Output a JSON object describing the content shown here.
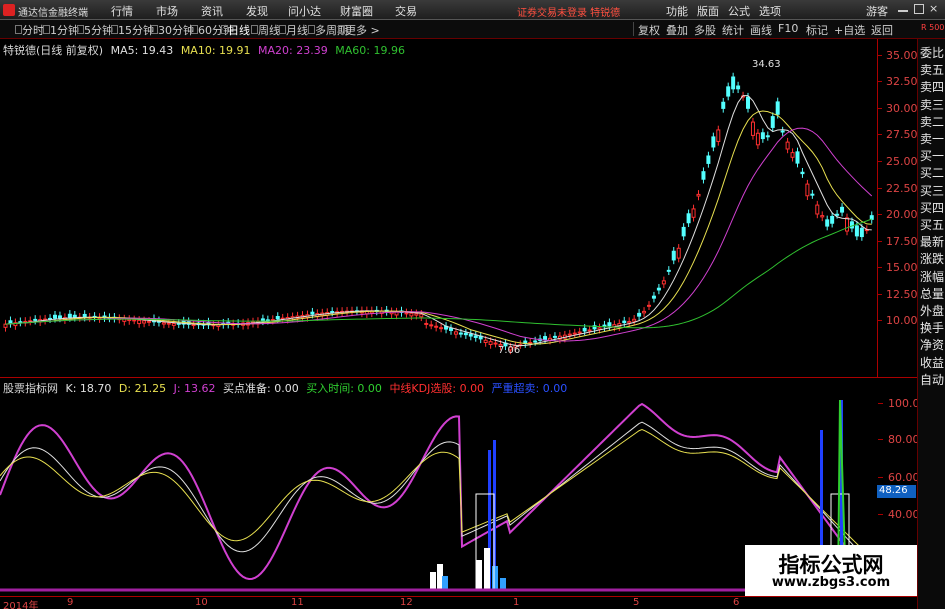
{
  "menubar": {
    "app_title": "通达信金融终端",
    "items": [
      "行情",
      "市场",
      "资讯",
      "发现",
      "问小达",
      "财富圈",
      "交易"
    ],
    "status": "证券交易未登录  特锐德",
    "right_items": [
      "功能",
      "版面",
      "公式",
      "选项"
    ],
    "guest": "游客"
  },
  "toolbar": {
    "periods": [
      "分时",
      "1分钟",
      "5分钟",
      "15分钟",
      "30分钟",
      "60分钟",
      "日线",
      "周线",
      "月线",
      "多周期",
      "更多 >"
    ],
    "active_period": "日线",
    "right_tools": [
      "复权",
      "叠加",
      "多股",
      "统计",
      "画线",
      "F10",
      "标记",
      "+自选",
      "返回"
    ]
  },
  "price_panel": {
    "stock_name": "特锐德(日线 前复权)",
    "ma5": "MA5: 19.43",
    "ma10": "MA10: 19.91",
    "ma20": "MA20: 23.39",
    "ma60": "MA60: 19.96",
    "high_label": "34.63",
    "low_label": "7.06",
    "axis": [
      "35.00",
      "32.50",
      "30.00",
      "27.50",
      "25.00",
      "22.50",
      "20.00",
      "17.50",
      "15.00",
      "12.50",
      "10.00"
    ]
  },
  "indicator_panel": {
    "name": "股票指标网",
    "k": "K: 18.70",
    "d": "D: 21.25",
    "j": "J: 13.62",
    "buy_prep": "买点准备: 0.00",
    "buy_time": "买入时间: 0.00",
    "zx_kdj": "中线KDJ选股: 0.00",
    "deep": "严重超卖: 0.00",
    "axis": [
      "100.0",
      "80.00",
      "60.00",
      "40.00"
    ],
    "current": "48.26"
  },
  "side_panel": {
    "tabs": [
      "委比",
      "卖五",
      "卖四",
      "卖三",
      "卖二",
      "卖一",
      "买一",
      "买二",
      "买三",
      "买四",
      "买五",
      "最新",
      "涨跌",
      "涨幅",
      "总量",
      "外盘",
      "换手",
      "净资",
      "收益",
      "自动"
    ],
    "r_label": "R 500"
  },
  "date_axis": [
    "2014年",
    "9",
    "10",
    "11",
    "12",
    "1",
    "5",
    "6"
  ],
  "watermark": {
    "title": "指标公式网",
    "url": "www.zbgs3.com"
  },
  "colors": {
    "up": "#ff3030",
    "down": "#54ffff",
    "ma5": "#e0e0e0",
    "ma10": "#e8e050",
    "ma20": "#d040d0",
    "ma60": "#30c030",
    "k_line": "#e0e0e0",
    "d_line": "#e8e050",
    "j_line": "#d040d0"
  }
}
